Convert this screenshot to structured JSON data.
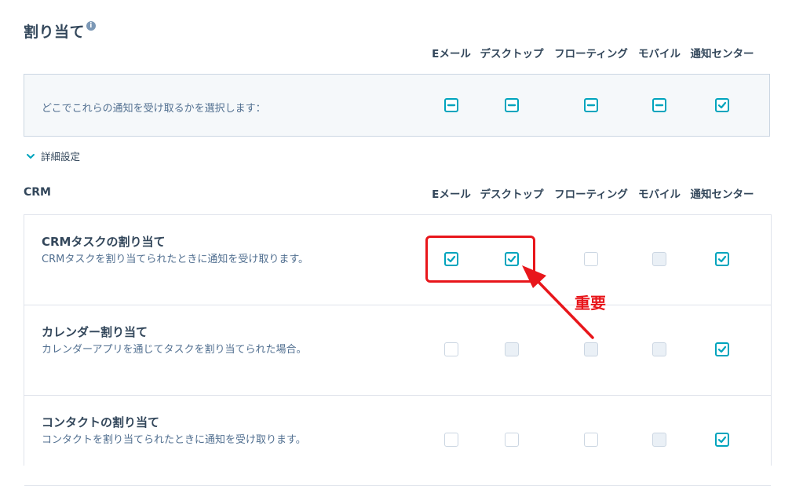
{
  "section": {
    "title": "割り当て",
    "info_icon": "info-icon"
  },
  "columns": [
    "Eメール",
    "デスクトップ",
    "フローティング",
    "モバイル",
    "通知センター"
  ],
  "master": {
    "label": "どこでこれらの通知を受け取るかを選択します：",
    "states": [
      "mixed",
      "mixed",
      "mixed",
      "mixed",
      "checked"
    ]
  },
  "advanced": {
    "label": "詳細設定",
    "icon": "chevron-down-icon"
  },
  "crm": {
    "title": "CRM",
    "columns": [
      "Eメール",
      "デスクトップ",
      "フローティング",
      "モバイル",
      "通知センター"
    ],
    "rows": [
      {
        "title": "CRMタスクの割り当て",
        "desc": "CRMタスクを割り当てられたときに通知を受け取ります。",
        "states": [
          "checked",
          "checked",
          "empty",
          "disabled",
          "checked"
        ]
      },
      {
        "title": "カレンダー割り当て",
        "desc": "カレンダーアプリを通じてタスクを割り当てられた場合。",
        "states": [
          "empty",
          "disabled",
          "disabled",
          "disabled",
          "checked"
        ]
      },
      {
        "title": "コンタクトの割り当て",
        "desc": "コンタクトを割り当てられたときに通知を受け取ります。",
        "states": [
          "empty",
          "empty",
          "empty",
          "disabled",
          "checked"
        ]
      }
    ]
  },
  "annotation": {
    "label": "重要",
    "color": "#e8161b"
  },
  "colors": {
    "accent": "#00a4bd",
    "text": "#33475b",
    "border": "#cbd6e2"
  }
}
